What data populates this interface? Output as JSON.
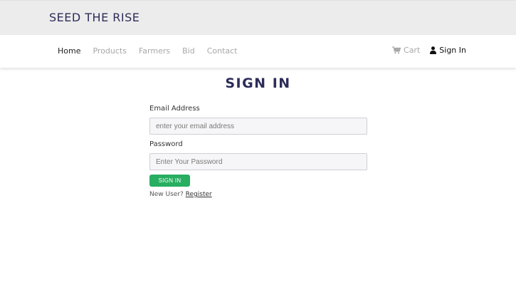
{
  "brand": {
    "name": "SEED THE RISE"
  },
  "nav": {
    "items": [
      {
        "label": "Home",
        "active": true
      },
      {
        "label": "Products",
        "active": false
      },
      {
        "label": "Farmers",
        "active": false
      },
      {
        "label": "Bid",
        "active": false
      },
      {
        "label": "Contact",
        "active": false
      }
    ],
    "cart_label": "Cart",
    "cart_icon": "shopping-cart-icon",
    "signin_label": "Sign In",
    "signin_icon": "user-icon"
  },
  "page": {
    "title": "SIGN IN"
  },
  "form": {
    "email_label": "Email Address",
    "email_placeholder": "enter your email address",
    "email_value": "",
    "password_label": "Password",
    "password_placeholder": "Enter Your Password",
    "password_value": "",
    "submit_label": "SIGN IN",
    "new_user_text": "New User?",
    "register_label": "Register"
  },
  "colors": {
    "banner_bg": "#ececec",
    "brand_text": "#2d2d5a",
    "accent_button": "#27ae60",
    "nav_inactive": "#a8a8a8"
  }
}
